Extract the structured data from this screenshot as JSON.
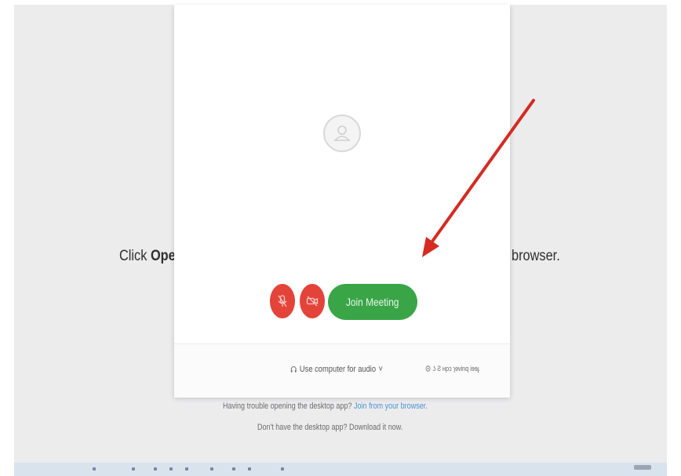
{
  "background_text": {
    "left_prefix": "Click ",
    "left_bold": "Ope",
    "right": "browser."
  },
  "modal": {
    "avatar_icon": "user-icon",
    "mic_icon": "microphone-off-icon",
    "video_icon": "video-off-icon",
    "join_label": "Join Meeting",
    "audio_icon": "headset-icon",
    "audio_option": "Use computer for audio",
    "audio_chevron": "˅",
    "right_option": "ʖ Ƨ ʜpɔ ɿɘvinq iɘɘɟ"
  },
  "help": {
    "trouble_text": "Having trouble opening the desktop app?",
    "trouble_link": "Join from your browser.",
    "download_text": "Don't have the desktop app? Download it now."
  },
  "colors": {
    "join_green": "#3aa547",
    "mute_red": "#e4433a",
    "arrow_red": "#d42b22",
    "link_blue": "#4a90d4"
  }
}
